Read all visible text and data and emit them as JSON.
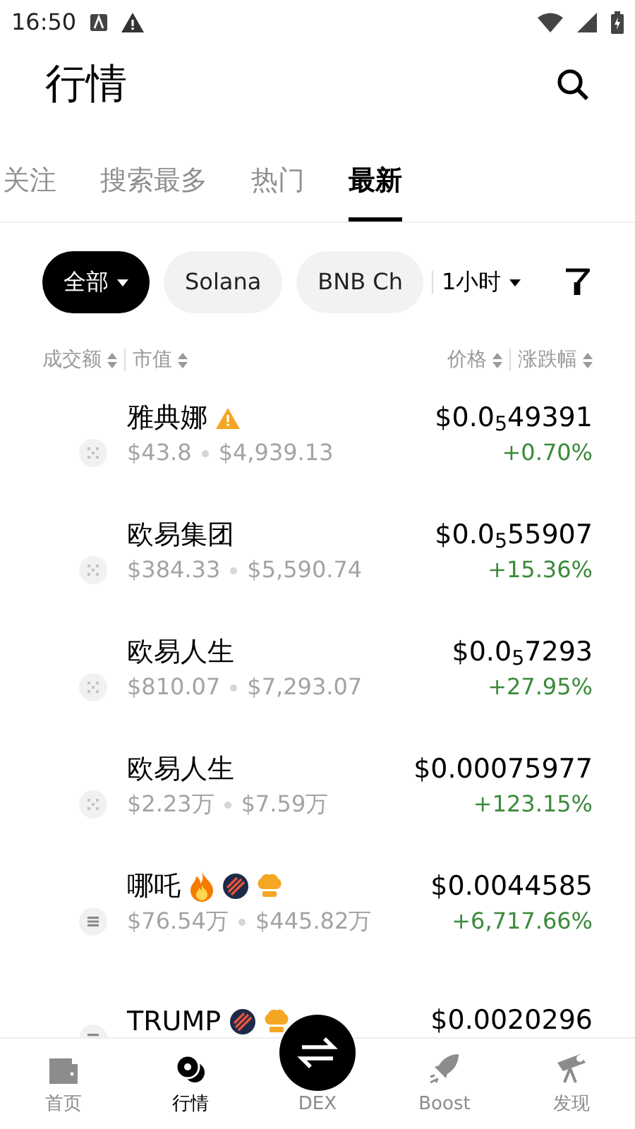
{
  "status_bar": {
    "time": "16:50"
  },
  "header": {
    "title": "行情"
  },
  "tabs": [
    {
      "label": "关注",
      "selected": false
    },
    {
      "label": "搜索最多",
      "selected": false
    },
    {
      "label": "热门",
      "selected": false
    },
    {
      "label": "最新",
      "selected": true
    }
  ],
  "chips": [
    {
      "label": "全部",
      "selected": true,
      "dropdown": true
    },
    {
      "label": "Solana",
      "selected": false,
      "dropdown": false
    },
    {
      "label": "BNB Ch",
      "selected": false,
      "dropdown": false
    }
  ],
  "timeframe": {
    "label": "1小时"
  },
  "columns_left": [
    "成交额",
    "市值"
  ],
  "columns_right": [
    "价格",
    "涨跌幅"
  ],
  "rows": [
    {
      "name": "雅典娜",
      "kind": "grid",
      "badges": [
        {
          "kind": "warning"
        }
      ],
      "volume": "$43.8",
      "market_cap": "$4,939.13",
      "price": "$0.0$_{5}$49391",
      "change": "+0.70%"
    },
    {
      "name": "欧易集团",
      "kind": "grid",
      "badges": [],
      "volume": "$384.33",
      "market_cap": "$5,590.74",
      "price": "$0.0$_{5}$55907",
      "change": "+15.36%"
    },
    {
      "name": "欧易人生",
      "kind": "grid",
      "badges": [],
      "volume": "$810.07",
      "market_cap": "$7,293.07",
      "price": "$0.0$_{5}$7293",
      "change": "+27.95%"
    },
    {
      "name": "欧易人生",
      "kind": "grid",
      "badges": [],
      "volume": "$2.23万",
      "market_cap": "$7.59万",
      "price": "$0.00075977",
      "change": "+123.15%"
    },
    {
      "name": "哪吒",
      "kind": "bars",
      "badges": [
        {
          "kind": "fire"
        },
        {
          "kind": "striped"
        },
        {
          "kind": "chef"
        }
      ],
      "volume": "$76.54万",
      "market_cap": "$445.82万",
      "price": "$0.0044585",
      "change": "+6,717.66%"
    },
    {
      "name": "TRUMP",
      "kind": "bars",
      "badges": [
        {
          "kind": "striped"
        },
        {
          "kind": "chef"
        }
      ],
      "price": "$0.0020296"
    }
  ],
  "nav": [
    {
      "label": "首页",
      "kind": "wallet",
      "selected": false
    },
    {
      "label": "行情",
      "kind": "coins",
      "selected": true
    },
    {
      "label": "DEX",
      "kind": "swap",
      "selected": false
    },
    {
      "label": "Boost",
      "kind": "rocket",
      "selected": false
    },
    {
      "label": "发现",
      "kind": "telescope",
      "selected": false
    }
  ]
}
